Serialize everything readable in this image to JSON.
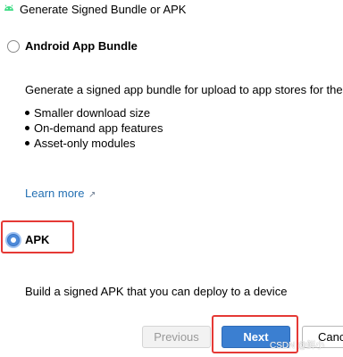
{
  "dialog": {
    "title": "Generate Signed Bundle or APK"
  },
  "options": {
    "bundle": {
      "label": "Android App Bundle",
      "description": "Generate a signed app bundle for upload to app stores for the",
      "bullets": [
        "Smaller download size",
        "On-demand app features",
        "Asset-only modules"
      ],
      "learn_more": "Learn more",
      "learn_more_icon": "external-link-arrow"
    },
    "apk": {
      "label": "APK",
      "description": "Build a signed APK that you can deploy to a device",
      "selected": true
    }
  },
  "buttons": {
    "previous": "Previous",
    "next": "Next",
    "cancel": "Canc"
  },
  "watermark": "CSDN @鲜小",
  "colors": {
    "accent": "#3b7fd1",
    "link": "#2470b3",
    "highlight_box": "#e53935"
  }
}
